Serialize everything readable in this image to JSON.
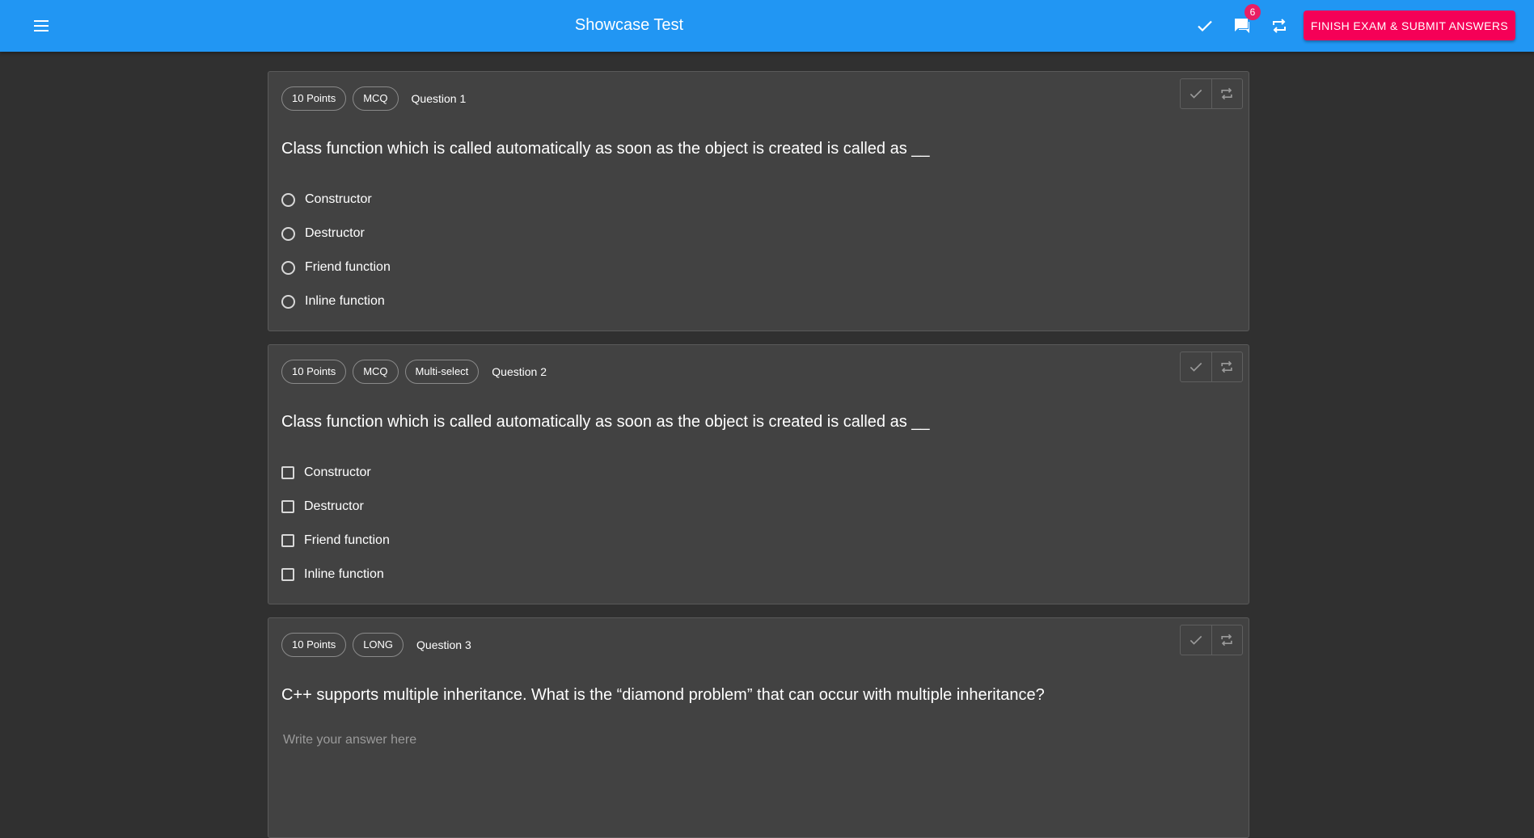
{
  "app": {
    "title": "Showcase Test",
    "notification_count": "6",
    "finish_label": "FINISH EXAM & SUBMIT ANSWERS",
    "colors": {
      "appbar": "#2196f3",
      "accent": "#f50057",
      "badge": "#e91e63",
      "background": "#303030",
      "card": "#424242"
    },
    "icons": [
      "menu-icon",
      "check-icon",
      "chat-icon",
      "repeat-icon"
    ]
  },
  "questions": [
    {
      "points": "10 Points",
      "type": "MCQ",
      "label": "Question 1",
      "text": "Class function which is called automatically as soon as the object is created is called as __",
      "options": [
        "Constructor",
        "Destructor",
        "Friend function",
        "Inline function"
      ]
    },
    {
      "points": "10 Points",
      "type": "MCQ",
      "subtype": "Multi-select",
      "label": "Question 2",
      "text": "Class function which is called automatically as soon as the object is created is called as __",
      "options": [
        "Constructor",
        "Destructor",
        "Friend function",
        "Inline function"
      ]
    },
    {
      "points": "10 Points",
      "type": "LONG",
      "label": "Question 3",
      "text": "C++ supports multiple inheritance. What is the “diamond problem” that can occur with multiple inheritance?",
      "answer_placeholder": "Write your answer here",
      "answer_value": ""
    }
  ]
}
